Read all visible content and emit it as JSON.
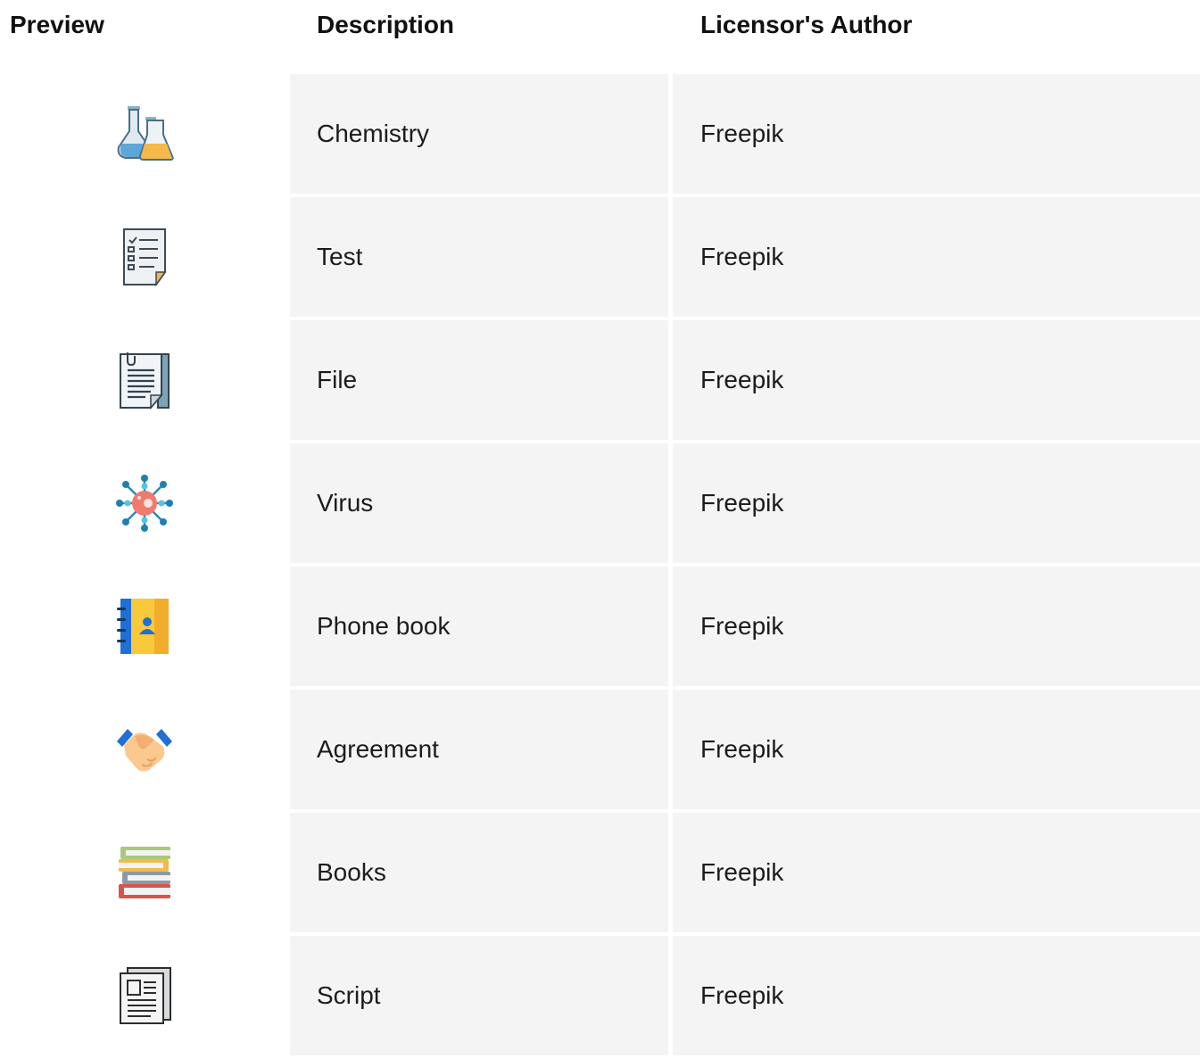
{
  "headers": {
    "preview": "Preview",
    "description": "Description",
    "author": "Licensor's Author"
  },
  "rows": [
    {
      "icon": "chemistry-flasks-icon",
      "description": "Chemistry",
      "author": "Freepik"
    },
    {
      "icon": "test-checklist-icon",
      "description": "Test",
      "author": "Freepik"
    },
    {
      "icon": "file-document-icon",
      "description": "File",
      "author": "Freepik"
    },
    {
      "icon": "virus-icon",
      "description": "Virus",
      "author": "Freepik"
    },
    {
      "icon": "phone-book-icon",
      "description": "Phone book",
      "author": "Freepik"
    },
    {
      "icon": "agreement-handshake-icon",
      "description": "Agreement",
      "author": "Freepik"
    },
    {
      "icon": "books-stack-icon",
      "description": "Books",
      "author": "Freepik"
    },
    {
      "icon": "script-document-icon",
      "description": "Script",
      "author": "Freepik"
    }
  ]
}
